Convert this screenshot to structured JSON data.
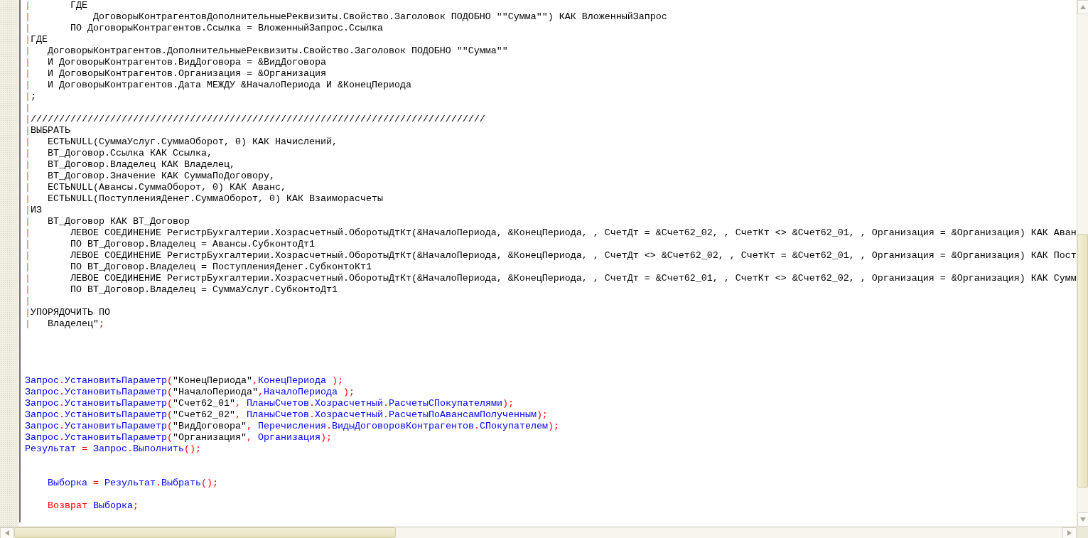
{
  "editor": {
    "lines": [
      {
        "kind": "code",
        "segments": [
          {
            "kind": "bar",
            "text": "|"
          },
          {
            "kind": "plain",
            "text": "       ГДЕ"
          }
        ]
      },
      {
        "kind": "code",
        "segments": [
          {
            "kind": "bar",
            "text": "|"
          },
          {
            "kind": "plain",
            "text": "           ДоговорыКонтрагентовДополнительныеРеквизиты.Свойство.Заголовок ПОДОБНО \"\"Сумма\"\") КАК ВложенныйЗапрос"
          }
        ]
      },
      {
        "kind": "code",
        "segments": [
          {
            "kind": "bar",
            "text": "|"
          },
          {
            "kind": "plain",
            "text": "       ПО ДоговорыКонтрагентов.Ссылка = ВложенныйЗапрос.Ссылка"
          }
        ]
      },
      {
        "kind": "code",
        "segments": [
          {
            "kind": "bar",
            "text": "|"
          },
          {
            "kind": "plain",
            "text": "ГДЕ"
          }
        ]
      },
      {
        "kind": "code",
        "segments": [
          {
            "kind": "bar",
            "text": "|"
          },
          {
            "kind": "plain",
            "text": "   ДоговорыКонтрагентов.ДополнительныеРеквизиты.Свойство.Заголовок ПОДОБНО \"\"Сумма\"\""
          }
        ]
      },
      {
        "kind": "code",
        "segments": [
          {
            "kind": "bar",
            "text": "|"
          },
          {
            "kind": "plain",
            "text": "   И ДоговорыКонтрагентов.ВидДоговора = &ВидДоговора"
          }
        ]
      },
      {
        "kind": "code",
        "segments": [
          {
            "kind": "bar",
            "text": "|"
          },
          {
            "kind": "plain",
            "text": "   И ДоговорыКонтрагентов.Организация = &Организация"
          }
        ]
      },
      {
        "kind": "code",
        "segments": [
          {
            "kind": "bar",
            "text": "|"
          },
          {
            "kind": "plain",
            "text": "   И ДоговорыКонтрагентов.Дата МЕЖДУ &НачалоПериода И &КонецПериода"
          }
        ]
      },
      {
        "kind": "code",
        "segments": [
          {
            "kind": "bar",
            "text": "|"
          },
          {
            "kind": "plain",
            "text": ";"
          }
        ]
      },
      {
        "kind": "code",
        "segments": [
          {
            "kind": "bar",
            "text": "|"
          }
        ]
      },
      {
        "kind": "code",
        "segments": [
          {
            "kind": "bar",
            "text": "|"
          },
          {
            "kind": "plain",
            "text": "////////////////////////////////////////////////////////////////////////////////"
          }
        ]
      },
      {
        "kind": "code",
        "segments": [
          {
            "kind": "bar",
            "text": "|"
          },
          {
            "kind": "plain",
            "text": "ВЫБРАТЬ"
          }
        ]
      },
      {
        "kind": "code",
        "segments": [
          {
            "kind": "bar",
            "text": "|"
          },
          {
            "kind": "plain",
            "text": "   ЕСТЬNULL(СуммаУслуг.СуммаОборот, 0) КАК Начислений,"
          }
        ]
      },
      {
        "kind": "code",
        "segments": [
          {
            "kind": "bar",
            "text": "|"
          },
          {
            "kind": "plain",
            "text": "   ВТ_Договор.Ссылка КАК Ссылка,"
          }
        ]
      },
      {
        "kind": "code",
        "segments": [
          {
            "kind": "bar",
            "text": "|"
          },
          {
            "kind": "plain",
            "text": "   ВТ_Договор.Владелец КАК Владелец,"
          }
        ]
      },
      {
        "kind": "code",
        "segments": [
          {
            "kind": "bar",
            "text": "|"
          },
          {
            "kind": "plain",
            "text": "   ВТ_Договор.Значение КАК СуммаПоДоговору,"
          }
        ]
      },
      {
        "kind": "code",
        "segments": [
          {
            "kind": "bar",
            "text": "|"
          },
          {
            "kind": "plain",
            "text": "   ЕСТЬNULL(Авансы.СуммаОборот, 0) КАК Аванс,"
          }
        ]
      },
      {
        "kind": "code",
        "segments": [
          {
            "kind": "bar",
            "text": "|"
          },
          {
            "kind": "plain",
            "text": "   ЕСТЬNULL(ПоступленияДенег.СуммаОборот, 0) КАК Взаиморасчеты"
          }
        ]
      },
      {
        "kind": "code",
        "segments": [
          {
            "kind": "bar",
            "text": "|"
          },
          {
            "kind": "plain",
            "text": "ИЗ"
          }
        ]
      },
      {
        "kind": "code",
        "segments": [
          {
            "kind": "bar",
            "text": "|"
          },
          {
            "kind": "plain",
            "text": "   ВТ_Договор КАК ВТ_Договор"
          }
        ]
      },
      {
        "kind": "code",
        "segments": [
          {
            "kind": "bar",
            "text": "|"
          },
          {
            "kind": "plain",
            "text": "       ЛЕВОЕ СОЕДИНЕНИЕ РегистрБухгалтерии.Хозрасчетный.ОборотыДтКт(&НачалоПериода, &КонецПериода, , СчетДт = &Счет62_02, , СчетКт <> &Счет62_01, , Организация = &Организация) КАК Аван"
          }
        ]
      },
      {
        "kind": "code",
        "segments": [
          {
            "kind": "bar",
            "text": "|"
          },
          {
            "kind": "plain",
            "text": "       ПО ВТ_Договор.Владелец = Авансы.СубконтоДт1"
          }
        ]
      },
      {
        "kind": "code",
        "segments": [
          {
            "kind": "bar",
            "text": "|"
          },
          {
            "kind": "plain",
            "text": "       ЛЕВОЕ СОЕДИНЕНИЕ РегистрБухгалтерии.Хозрасчетный.ОборотыДтКт(&НачалоПериода, &КонецПериода, , СчетДт <> &Счет62_02, , СчетКт = &Счет62_01, , Организация = &Организация) КАК Пост"
          }
        ]
      },
      {
        "kind": "code",
        "segments": [
          {
            "kind": "bar",
            "text": "|"
          },
          {
            "kind": "plain",
            "text": "       ПО ВТ_Договор.Владелец = ПоступленияДенег.СубконтоКт1"
          }
        ]
      },
      {
        "kind": "code",
        "segments": [
          {
            "kind": "bar",
            "text": "|"
          },
          {
            "kind": "plain",
            "text": "       ЛЕВОЕ СОЕДИНЕНИЕ РегистрБухгалтерии.Хозрасчетный.ОборотыДтКт(&НачалоПериода, &КонецПериода, , СчетДт = &Счет62_01, , СчетКт <> &Счет62_02, , Организация = &Организация) КАК Сумм"
          }
        ]
      },
      {
        "kind": "code",
        "segments": [
          {
            "kind": "bar",
            "text": "|"
          },
          {
            "kind": "plain",
            "text": "       ПО ВТ_Договор.Владелец = СуммаУслуг.СубконтоДт1"
          }
        ]
      },
      {
        "kind": "code",
        "segments": [
          {
            "kind": "bar",
            "text": "|"
          }
        ]
      },
      {
        "kind": "code",
        "segments": [
          {
            "kind": "bar",
            "text": "|"
          },
          {
            "kind": "plain",
            "text": "УПОРЯДОЧИТЬ ПО"
          }
        ]
      },
      {
        "kind": "code",
        "segments": [
          {
            "kind": "bar",
            "text": "|"
          },
          {
            "kind": "plain",
            "text": "   Владелец\""
          },
          {
            "kind": "symbol",
            "text": ";"
          }
        ]
      },
      {
        "kind": "blank"
      },
      {
        "kind": "blank"
      },
      {
        "kind": "blank"
      },
      {
        "kind": "blank"
      },
      {
        "kind": "code",
        "segments": [
          {
            "kind": "name",
            "text": "Запрос"
          },
          {
            "kind": "symbol",
            "text": "."
          },
          {
            "kind": "name",
            "text": "УстановитьПараметр"
          },
          {
            "kind": "symbol",
            "text": "("
          },
          {
            "kind": "plain",
            "text": "\"КонецПериода\""
          },
          {
            "kind": "symbol",
            "text": ","
          },
          {
            "kind": "name",
            "text": "КонецПериода"
          },
          {
            "kind": "symbol",
            "text": " );"
          }
        ]
      },
      {
        "kind": "code",
        "segments": [
          {
            "kind": "name",
            "text": "Запрос"
          },
          {
            "kind": "symbol",
            "text": "."
          },
          {
            "kind": "name",
            "text": "УстановитьПараметр"
          },
          {
            "kind": "symbol",
            "text": "("
          },
          {
            "kind": "plain",
            "text": "\"НачалоПериода\""
          },
          {
            "kind": "symbol",
            "text": ","
          },
          {
            "kind": "name",
            "text": "НачалоПериода"
          },
          {
            "kind": "symbol",
            "text": " );"
          }
        ]
      },
      {
        "kind": "code",
        "segments": [
          {
            "kind": "name",
            "text": "Запрос"
          },
          {
            "kind": "symbol",
            "text": "."
          },
          {
            "kind": "name",
            "text": "УстановитьПараметр"
          },
          {
            "kind": "symbol",
            "text": "("
          },
          {
            "kind": "plain",
            "text": "\"Счет62_01\""
          },
          {
            "kind": "symbol",
            "text": ", "
          },
          {
            "kind": "name",
            "text": "ПланыСчетов"
          },
          {
            "kind": "symbol",
            "text": "."
          },
          {
            "kind": "name",
            "text": "Хозрасчетный"
          },
          {
            "kind": "symbol",
            "text": "."
          },
          {
            "kind": "name",
            "text": "РасчетыСПокупателями"
          },
          {
            "kind": "symbol",
            "text": ");"
          }
        ]
      },
      {
        "kind": "code",
        "segments": [
          {
            "kind": "name",
            "text": "Запрос"
          },
          {
            "kind": "symbol",
            "text": "."
          },
          {
            "kind": "name",
            "text": "УстановитьПараметр"
          },
          {
            "kind": "symbol",
            "text": "("
          },
          {
            "kind": "plain",
            "text": "\"Счет62_02\""
          },
          {
            "kind": "symbol",
            "text": ", "
          },
          {
            "kind": "name",
            "text": "ПланыСчетов"
          },
          {
            "kind": "symbol",
            "text": "."
          },
          {
            "kind": "name",
            "text": "Хозрасчетный"
          },
          {
            "kind": "symbol",
            "text": "."
          },
          {
            "kind": "name",
            "text": "РасчетыПоАвансамПолученным"
          },
          {
            "kind": "symbol",
            "text": ");"
          }
        ]
      },
      {
        "kind": "code",
        "segments": [
          {
            "kind": "name",
            "text": "Запрос"
          },
          {
            "kind": "symbol",
            "text": "."
          },
          {
            "kind": "name",
            "text": "УстановитьПараметр"
          },
          {
            "kind": "symbol",
            "text": "("
          },
          {
            "kind": "plain",
            "text": "\"ВидДоговора\""
          },
          {
            "kind": "symbol",
            "text": ", "
          },
          {
            "kind": "name",
            "text": "Перечисления"
          },
          {
            "kind": "symbol",
            "text": "."
          },
          {
            "kind": "name",
            "text": "ВидыДоговоровКонтрагентов"
          },
          {
            "kind": "symbol",
            "text": "."
          },
          {
            "kind": "name",
            "text": "СПокупателем"
          },
          {
            "kind": "symbol",
            "text": ");"
          }
        ]
      },
      {
        "kind": "code",
        "segments": [
          {
            "kind": "name",
            "text": "Запрос"
          },
          {
            "kind": "symbol",
            "text": "."
          },
          {
            "kind": "name",
            "text": "УстановитьПараметр"
          },
          {
            "kind": "symbol",
            "text": "("
          },
          {
            "kind": "plain",
            "text": "\"Организация\""
          },
          {
            "kind": "symbol",
            "text": ", "
          },
          {
            "kind": "name",
            "text": "Организация"
          },
          {
            "kind": "symbol",
            "text": ");"
          }
        ]
      },
      {
        "kind": "code",
        "segments": [
          {
            "kind": "name",
            "text": "Результат"
          },
          {
            "kind": "symbol",
            "text": " = "
          },
          {
            "kind": "name",
            "text": "Запрос"
          },
          {
            "kind": "symbol",
            "text": "."
          },
          {
            "kind": "name",
            "text": "Выполнить"
          },
          {
            "kind": "symbol",
            "text": "();"
          }
        ]
      },
      {
        "kind": "blank"
      },
      {
        "kind": "blank"
      },
      {
        "kind": "code",
        "segments": [
          {
            "kind": "name",
            "text": "    Выборка"
          },
          {
            "kind": "symbol",
            "text": " = "
          },
          {
            "kind": "name",
            "text": "Результат"
          },
          {
            "kind": "symbol",
            "text": "."
          },
          {
            "kind": "name",
            "text": "Выбрать"
          },
          {
            "kind": "symbol",
            "text": "();"
          }
        ]
      },
      {
        "kind": "blank"
      },
      {
        "kind": "code",
        "segments": [
          {
            "kind": "keyword",
            "text": "    Возврат"
          },
          {
            "kind": "name",
            "text": " Выборка"
          },
          {
            "kind": "symbol",
            "text": ";"
          }
        ]
      }
    ]
  }
}
